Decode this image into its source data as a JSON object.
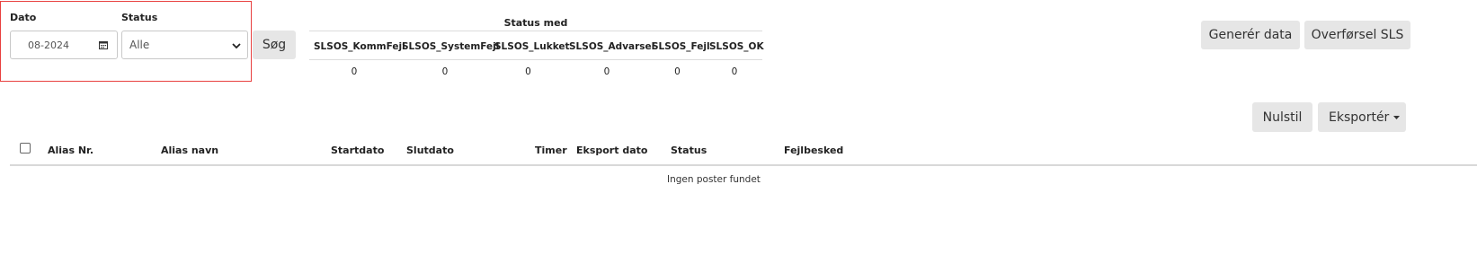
{
  "filter": {
    "date_label": "Dato",
    "date_value": "08-2024",
    "status_label": "Status",
    "status_value": "Alle",
    "search_button": "Søg"
  },
  "summary": {
    "title": "Status med",
    "columns": [
      {
        "label": "SLSOS_KommFejl",
        "value": "0"
      },
      {
        "label": "SLSOS_SystemFejl",
        "value": "0"
      },
      {
        "label": "SLSOS_Lukket",
        "value": "0"
      },
      {
        "label": "SLSOS_Advarsel",
        "value": "0"
      },
      {
        "label": "SLSOS_Fejl",
        "value": "0"
      },
      {
        "label": "SLSOS_OK",
        "value": "0"
      }
    ]
  },
  "actions": {
    "generate_button": "Generér data",
    "transfer_button": "Overførsel SLS",
    "reset_button": "Nulstil",
    "export_button": "Eksportér"
  },
  "table": {
    "headers": [
      "Alias Nr.",
      "Alias navn",
      "Startdato",
      "Slutdato",
      "Timer",
      "Eksport dato",
      "Status",
      "Fejlbesked"
    ],
    "empty_message": "Ingen poster fundet"
  },
  "colors": {
    "highlight_border": "#e8403f",
    "button_bg": "#e6e6e6"
  }
}
